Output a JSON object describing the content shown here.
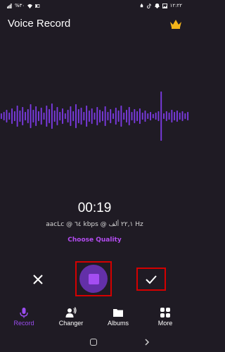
{
  "status_bar": {
    "left_text": "%٣٠",
    "time": "١٢:٢٢"
  },
  "header": {
    "title": "Voice Record",
    "premium_icon": "crown-icon"
  },
  "recording": {
    "timer": "00:19",
    "format_info": "aacLc @ ٦٤ kbps @ ٢٢,١ ألف Hz",
    "choose_quality_label": "Choose Quality"
  },
  "controls": {
    "cancel_icon": "close-icon",
    "stop_icon": "stop-icon",
    "confirm_icon": "check-icon"
  },
  "nav": {
    "items": [
      {
        "label": "Record",
        "icon": "mic-icon",
        "active": true
      },
      {
        "label": "Changer",
        "icon": "voice-changer-icon",
        "active": false
      },
      {
        "label": "Albums",
        "icon": "folder-icon",
        "active": false
      },
      {
        "label": "More",
        "icon": "grid-icon",
        "active": false
      }
    ]
  },
  "colors": {
    "background": "#1f1b24",
    "accent": "#9b4df0",
    "waveform": "#7a3ae0",
    "highlight_box": "#d40000"
  },
  "waveform": {
    "bars": [
      8,
      12,
      18,
      10,
      22,
      14,
      30,
      16,
      26,
      12,
      20,
      34,
      18,
      28,
      14,
      24,
      10,
      30,
      20,
      36,
      16,
      26,
      12,
      22,
      8,
      18,
      28,
      14,
      34,
      20,
      24,
      12,
      30,
      16,
      22,
      10,
      26,
      18,
      14,
      28,
      12,
      20,
      8,
      24,
      16,
      30,
      10,
      18,
      26,
      12,
      20,
      14,
      22,
      10,
      16,
      8,
      12,
      6,
      10,
      14,
      70,
      8,
      14,
      10,
      18,
      12,
      16,
      10,
      14,
      8,
      12
    ]
  }
}
